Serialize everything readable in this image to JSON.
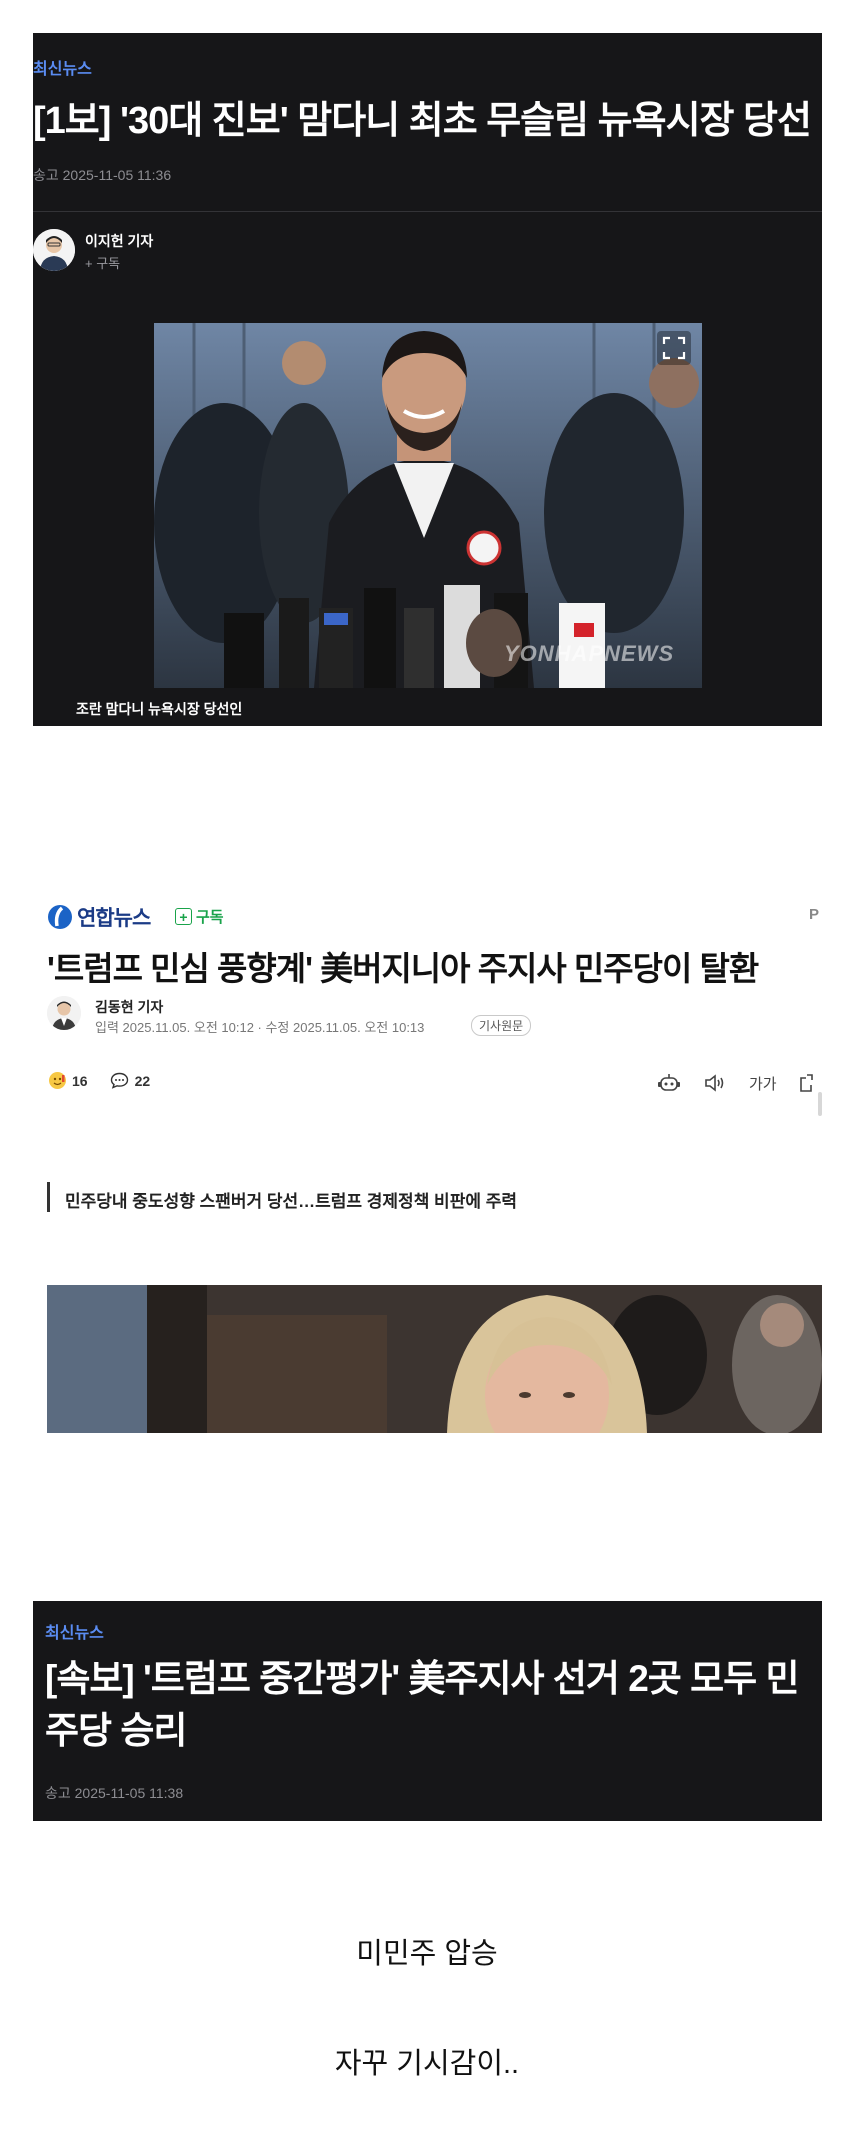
{
  "article1": {
    "section": "최신뉴스",
    "headline": "[1보] '30대 진보' 맘다니 최초 무슬림 뉴욕시장 당선",
    "meta": "송고 2025-11-05 11:36",
    "reporter": "이지헌 기자",
    "subscribe": "+ 구독",
    "watermark": "YONHAPNEWS",
    "caption": "조란 맘다니 뉴욕시장 당선인",
    "icons": [
      "expand-icon"
    ]
  },
  "article2": {
    "logo": "연합뉴스",
    "subscribe": "구독",
    "corner": "P",
    "headline": "'트럼프 민심 풍향계' 美버지니아 주지사 민주당이 탈환",
    "reporter": "김동현 기자",
    "dates": "입력 2025.11.05. 오전 10:12 · 수정 2025.11.05. 오전 10:13",
    "source_badge": "기사원문",
    "reaction_count": "16",
    "comment_count": "22",
    "font_tool": "가가",
    "summary": "민주당내 중도성향 스팬버거 당선…트럼프 경제정책 비판에 주력",
    "icons": [
      "reaction-emoji-icon",
      "comment-icon",
      "summary-bot-icon",
      "audio-icon",
      "font-size-icon",
      "share-icon"
    ]
  },
  "article3": {
    "section": "최신뉴스",
    "headline": "[속보] '트럼프 중간평가' 美주지사 선거 2곳 모두 민주당 승리",
    "meta": "송고 2025-11-05 11:38"
  },
  "notes": {
    "line1": "미민주 압승",
    "line2": "자꾸 기시감이.."
  },
  "colors": {
    "dark_card": "#161618",
    "section_blue": "#5a8cf2",
    "yonhap_navy": "#1b3b86",
    "subscribe_green": "#19a34a"
  }
}
